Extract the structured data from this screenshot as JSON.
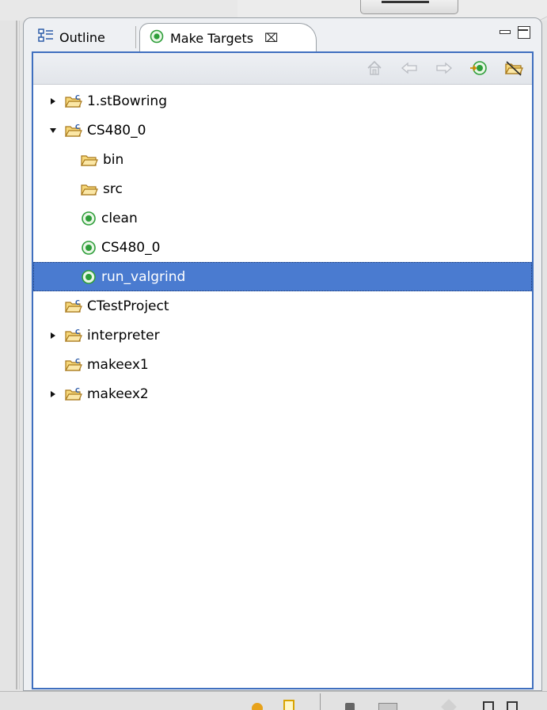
{
  "tabs": {
    "outline_label": "Outline",
    "make_targets_label": "Make Targets",
    "close_glyph": "⌧"
  },
  "tree": [
    {
      "label": "1.stBowring",
      "type": "project",
      "expander": "collapsed",
      "depth": 0
    },
    {
      "label": "CS480_0",
      "type": "project",
      "expander": "expanded",
      "depth": 0
    },
    {
      "label": "bin",
      "type": "folder",
      "expander": "none",
      "depth": 1
    },
    {
      "label": "src",
      "type": "folder",
      "expander": "none",
      "depth": 1
    },
    {
      "label": "clean",
      "type": "target",
      "expander": "none",
      "depth": 1
    },
    {
      "label": "CS480_0",
      "type": "target",
      "expander": "none",
      "depth": 1
    },
    {
      "label": "run_valgrind",
      "type": "target",
      "expander": "none",
      "depth": 1,
      "selected": true
    },
    {
      "label": "CTestProject",
      "type": "project",
      "expander": "none",
      "depth": 0
    },
    {
      "label": "interpreter",
      "type": "project",
      "expander": "collapsed",
      "depth": 0
    },
    {
      "label": "makeex1",
      "type": "project",
      "expander": "none",
      "depth": 0
    },
    {
      "label": "makeex2",
      "type": "project",
      "expander": "collapsed",
      "depth": 0
    }
  ],
  "colors": {
    "selection": "#4a7bd0",
    "focus_border": "#3f6fbf",
    "target_green": "#2e9e3a",
    "folder_yellow": "#f1c24c"
  }
}
